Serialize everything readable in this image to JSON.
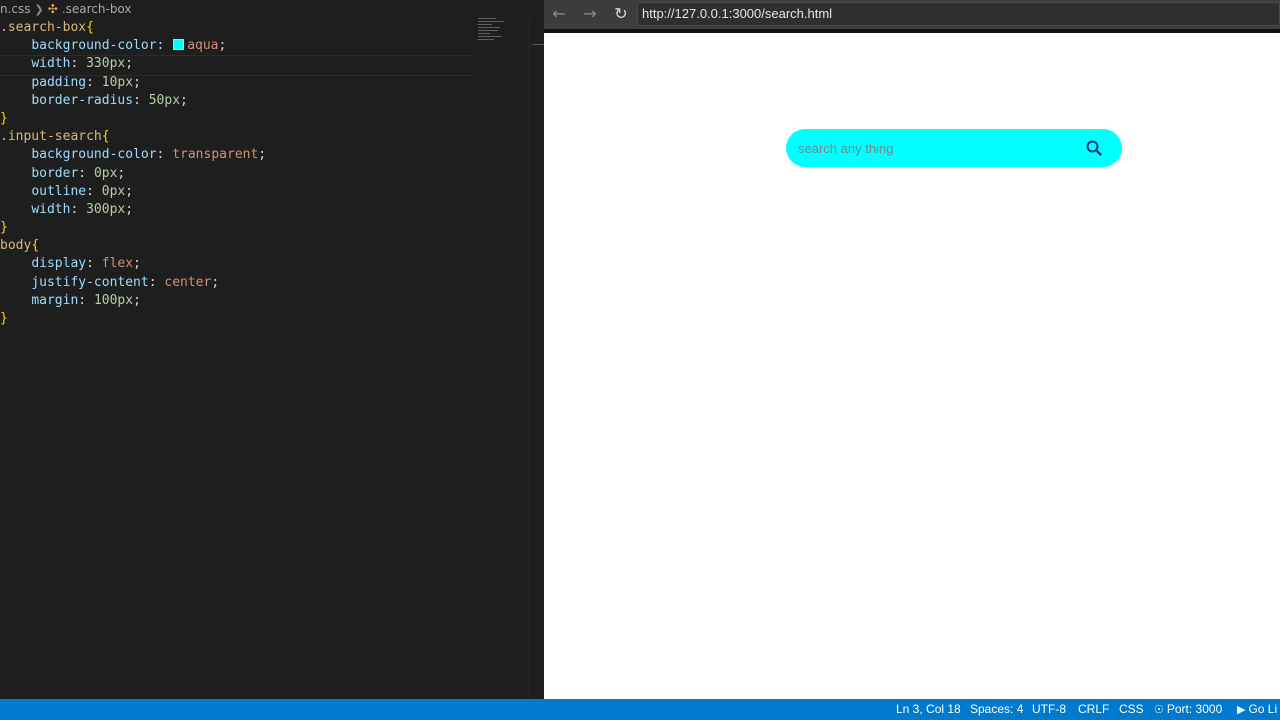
{
  "editor": {
    "breadcrumb": {
      "file": "n.css",
      "symbol": ".search-box"
    },
    "code": {
      "l1_selector": ".search-box",
      "l2_prop": "background-color",
      "l2_val": "aqua",
      "l2_swatch_color": "#00ffff",
      "l3_prop": "width",
      "l3_val": "330px",
      "l4_prop": "padding",
      "l4_val": "10px",
      "l5_prop": "border-radius",
      "l5_val": "50px",
      "l7_selector": ".input-search",
      "l8_prop": "background-color",
      "l8_val": "transparent",
      "l9_prop": "border",
      "l9_val": "0px",
      "l10_prop": "outline",
      "l10_val": "0px",
      "l11_prop": "width",
      "l11_val": "300px",
      "l13_selector": "body",
      "l14_prop": "display",
      "l14_val": "flex",
      "l15_prop": "justify-content",
      "l15_val": "center",
      "l16_prop": "margin",
      "l16_val": "100px"
    }
  },
  "browser": {
    "back_icon": "←",
    "forward_icon": "→",
    "reload_icon": "↻",
    "url": "http://127.0.0.1:3000/search.html",
    "search_placeholder": "search any thing"
  },
  "status": {
    "position": "Ln 3, Col 18",
    "spaces": "Spaces: 4",
    "encoding": "UTF-8",
    "eol": "CRLF",
    "language": "CSS",
    "port": "Port: 3000",
    "go_live": "Go Li"
  },
  "colors": {
    "status_bar": "#007acc",
    "search_box": "#00ffff",
    "editor_bg": "#1e1e1e"
  }
}
